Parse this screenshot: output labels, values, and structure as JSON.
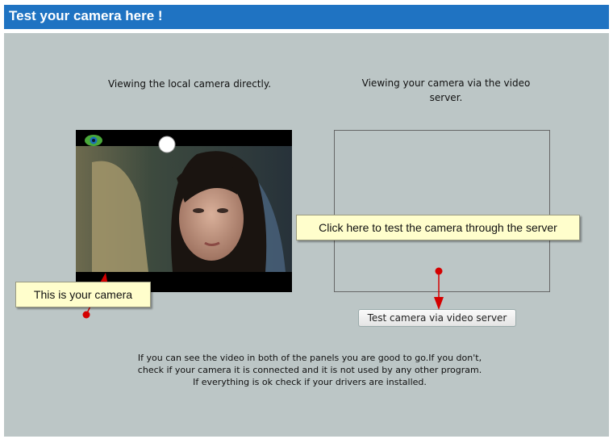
{
  "header": {
    "title": "Test your camera here !"
  },
  "captions": {
    "local": "Viewing the local camera directly.",
    "server": "Viewing your camera via the video server."
  },
  "callouts": {
    "server": "Click here to test the camera through the server",
    "camera": "This is your camera"
  },
  "button": {
    "label": "Test camera via video server"
  },
  "info": "If you can see the video in both of the panels you are good to go.If you don't, check if your camera it is connected and it is not used by any other program. If everything is ok check if your drivers are installed.",
  "colors": {
    "header": "#1f73c2",
    "panel": "#bcc6c6",
    "callout": "#fffecc",
    "arrow": "#d40000"
  },
  "icons": {
    "video_badge": "eye-icon"
  }
}
